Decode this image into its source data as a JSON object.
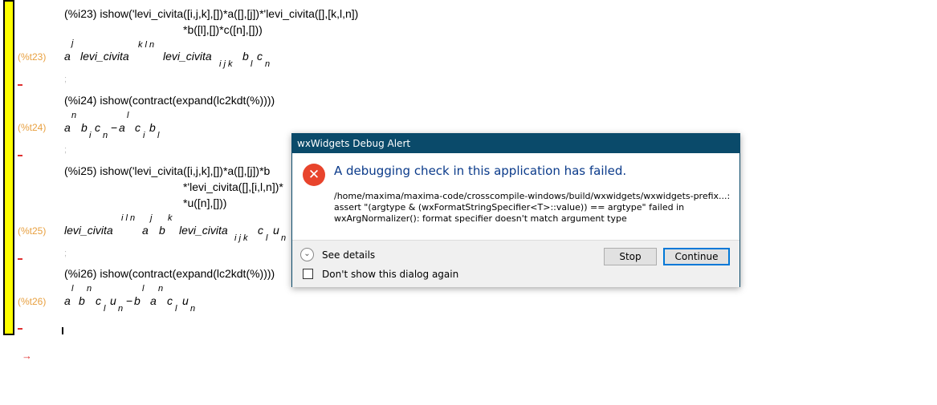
{
  "notebook": {
    "cells": [
      {
        "input_prompt": "(%i23)",
        "input_line1": "ishow('levi_civita([i,j,k],[])*a([],[j])*'levi_civita([],[k,l,n])",
        "input_line2": "*b([l],[])*c([n],[]))",
        "output_label": "(%t23)",
        "output": {
          "t1": "a",
          "t1_sup": "j",
          "t2": "levi_civita",
          "t2_sup": "k l n",
          "t3": "levi_civita",
          "t3_sub": "i j k",
          "t4": "b",
          "t4_sub": "l",
          "t5": "c",
          "t5_sub": "n"
        }
      },
      {
        "input_prompt": "(%i24)",
        "input_line1": "ishow(contract(expand(lc2kdt(%))))",
        "output_label": "(%t24)",
        "output": {
          "t1": "a",
          "t1_sup": "n",
          "t2": "b",
          "t2_sub": "i",
          "t3": "c",
          "t3_sub": "n",
          "op": "−",
          "t4": "a",
          "t4_sup": "l",
          "t5": "c",
          "t5_sub": "i",
          "t6": "b",
          "t6_sub": "l"
        }
      },
      {
        "input_prompt": "(%i25)",
        "input_line1": "ishow('levi_civita([i,j,k],[])*a([],[j])*b",
        "input_line2": "*'levi_civita([],[i,l,n])*",
        "input_line3": "*u([n],[]))",
        "output_label": "(%t25)",
        "output": {
          "t1": "levi_civita",
          "t1_sup": "i l n",
          "t2": "a",
          "t2_sup": "j",
          "t3": "b",
          "t3_sup": "k",
          "t4": "levi_civita",
          "t4_sub": "i j k",
          "t5": "c",
          "t5_sub": "l",
          "t6": "u",
          "t6_sub": "n"
        }
      },
      {
        "input_prompt": "(%i26)",
        "input_line1": "ishow(contract(expand(lc2kdt(%))))",
        "output_label": "(%t26)",
        "output": {
          "t1": "a",
          "t1_sup": "l",
          "t2": "b",
          "t2_sup": "n",
          "t3": "c",
          "t3_sub": "l",
          "t4": "u",
          "t4_sub": "n",
          "op": "−",
          "t5": "b",
          "t5_sup": "l",
          "t6": "a",
          "t6_sup": "n",
          "t7": "c",
          "t7_sub": "l",
          "t8": "u",
          "t8_sub": "n"
        }
      }
    ],
    "semicolon": ";",
    "cursor_arrow": "→",
    "colors": {
      "bracket": "#ffff00",
      "output_label": "#e8a040",
      "marker": "#e03030"
    }
  },
  "dialog": {
    "title": "wxWidgets Debug Alert",
    "icon": "error-x-icon",
    "heading": "A debugging check in this application has failed.",
    "message_line1": "/home/maxima/maxima-code/crosscompile-windows/build/wxwidgets/wxwidgets-prefix...:",
    "message_line2": "assert \"(argtype & (wxFormatStringSpecifier<T>::value)) == argtype\" failed in",
    "message_line3": "wxArgNormalizer(): format specifier doesn't match argument type",
    "see_details": "See details",
    "dont_show": "Don't show this dialog again",
    "stop_button": "Stop",
    "continue_button": "Continue",
    "colors": {
      "title_bar": "#0a4a6a",
      "heading": "#0a3a8a",
      "icon": "#e8442c"
    }
  }
}
